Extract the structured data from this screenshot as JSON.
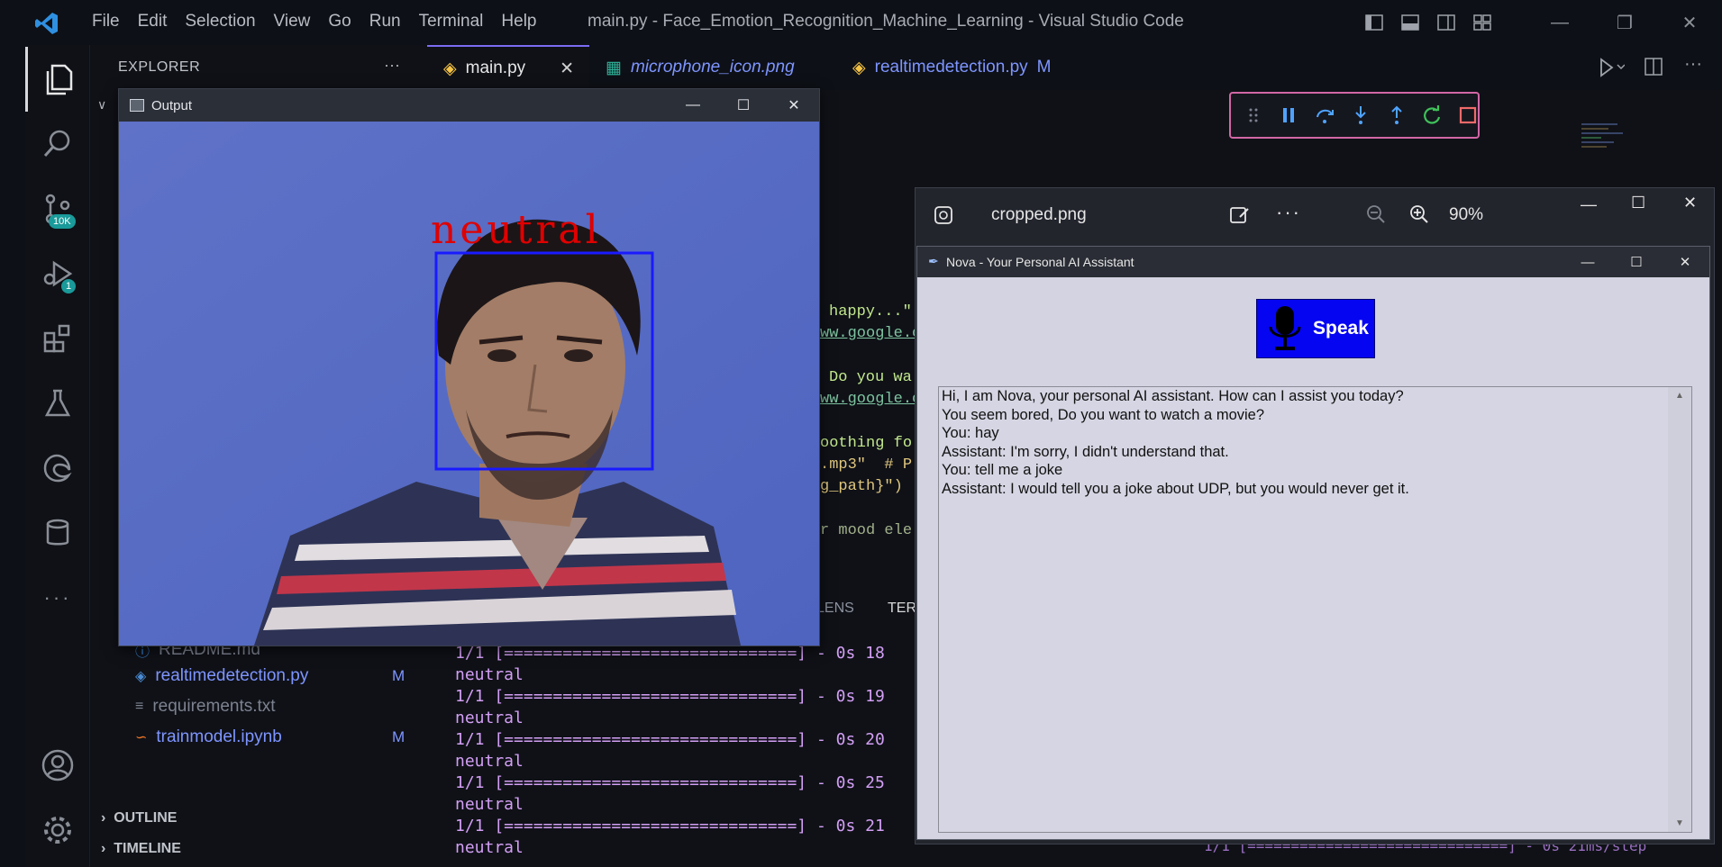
{
  "titlebar": {
    "menu": [
      "File",
      "Edit",
      "Selection",
      "View",
      "Go",
      "Run",
      "Terminal",
      "Help"
    ],
    "window_title": "main.py - Face_Emotion_Recognition_Machine_Learning - Visual Studio Code"
  },
  "activity": {
    "scm_badge": "10K",
    "debug_badge": "1"
  },
  "sidebar": {
    "title": "EXPLORER",
    "files": [
      {
        "name": "README.md",
        "badge": ""
      },
      {
        "name": "realtimedetection.py",
        "badge": "M"
      },
      {
        "name": "requirements.txt",
        "badge": ""
      },
      {
        "name": "trainmodel.ipynb",
        "badge": "M"
      }
    ],
    "sections": [
      "OUTLINE",
      "TIMELINE"
    ]
  },
  "tabs": [
    {
      "label": "main.py",
      "modified": ""
    },
    {
      "label": "microphone_icon.png",
      "modified": ""
    },
    {
      "label": "realtimedetection.py",
      "modified": "M"
    }
  ],
  "code_fragments": [
    "happy...\"",
    "ww.google.c",
    "Do you wa",
    "ww.google.c",
    "oothing fo",
    ".mp3\"  # P",
    "g_path}\")",
    "r mood ele"
  ],
  "panel_tabs": [
    "LENS",
    "TER"
  ],
  "terminal": [
    "1/1 [==============================] - 0s 18",
    "neutral",
    "1/1 [==============================] - 0s 19",
    "neutral",
    "1/1 [==============================] - 0s 20",
    "neutral",
    "1/1 [==============================] - 0s 25",
    "neutral",
    "1/1 [==============================] - 0s 21",
    "neutral"
  ],
  "output_window": {
    "title": "Output",
    "emotion_label": "neutral"
  },
  "photos": {
    "filename": "cropped.png",
    "zoom": "90%"
  },
  "nova": {
    "title": "Nova - Your Personal AI Assistant",
    "speak_label": "Speak",
    "chat": [
      "Hi, I am Nova, your personal AI assistant. How can I assist you today?",
      "You seem bored, Do you want to watch a movie?",
      "You: hay",
      "Assistant: I'm sorry, I didn't understand that.",
      "You: tell me a joke",
      "Assistant: I would tell you a joke about UDP, but you would never get it."
    ]
  },
  "bottom_terminal_partial": "1/1 [==============================] - 0s 21ms/step",
  "colors": {
    "accent": "#d267a6",
    "link_blue": "#7e95ff",
    "terminal_purple": "#d39ff4",
    "speak_blue": "#0505f2",
    "face_box": "#1a1aff",
    "emotion_text": "#e00000"
  }
}
